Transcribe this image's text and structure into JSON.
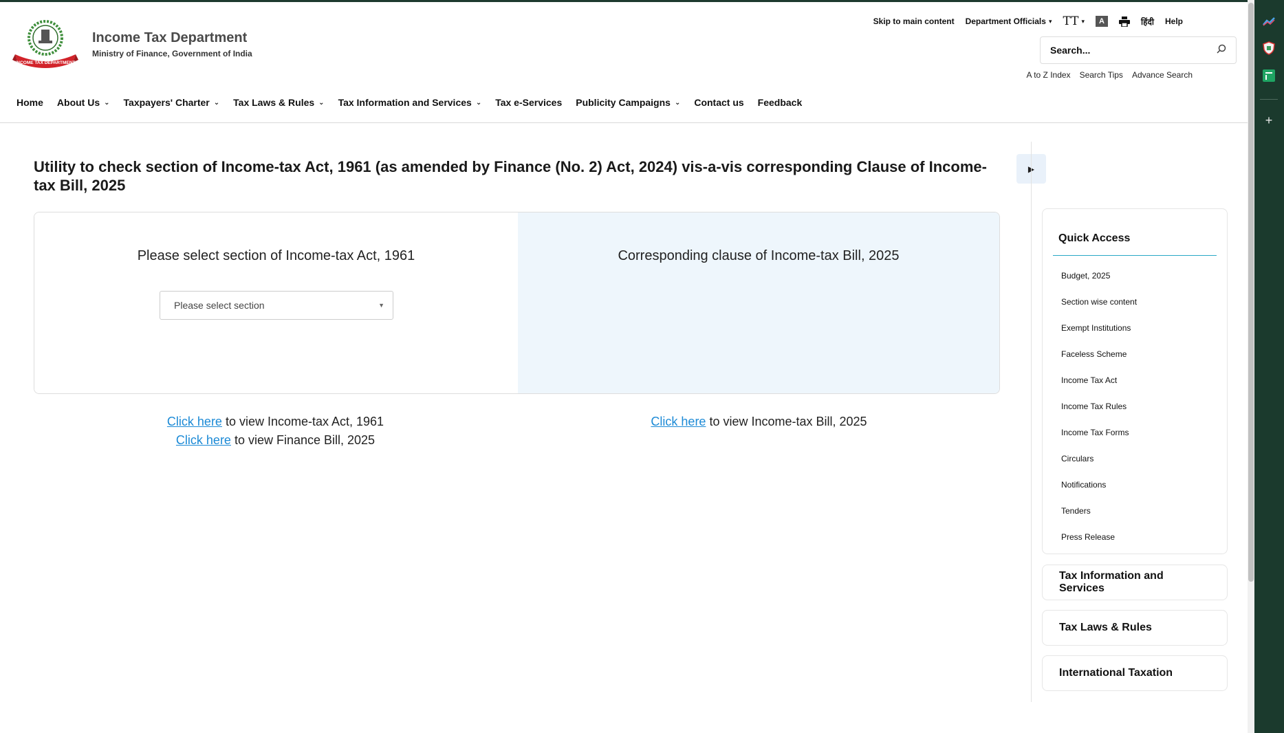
{
  "header": {
    "logo_ribbon": "INCOME TAX DEPARTMENT",
    "title": "Income Tax Department",
    "subtitle": "Ministry of Finance, Government of India"
  },
  "utility": {
    "skip": "Skip to main content",
    "officials": "Department Officials",
    "text_size": "TT",
    "contrast": "A",
    "hindi": "हिंदी",
    "help": "Help"
  },
  "search": {
    "placeholder": "Search...",
    "links": [
      "A to Z Index",
      "Search Tips",
      "Advance Search"
    ]
  },
  "nav": [
    {
      "label": "Home",
      "dropdown": false
    },
    {
      "label": "About Us",
      "dropdown": true
    },
    {
      "label": "Taxpayers' Charter",
      "dropdown": true
    },
    {
      "label": "Tax Laws & Rules",
      "dropdown": true
    },
    {
      "label": "Tax Information and Services",
      "dropdown": true
    },
    {
      "label": "Tax e-Services",
      "dropdown": false
    },
    {
      "label": "Publicity Campaigns",
      "dropdown": true
    },
    {
      "label": "Contact us",
      "dropdown": false
    },
    {
      "label": "Feedback",
      "dropdown": false
    }
  ],
  "main": {
    "title": "Utility to check section of Income-tax Act, 1961 (as amended by Finance (No. 2) Act, 2024) vis-a-vis corresponding Clause of Income-tax Bill, 2025",
    "left_heading": "Please select section of Income-tax Act, 1961",
    "select_placeholder": "Please select section",
    "right_heading": "Corresponding clause of Income-tax Bill, 2025",
    "link_text": "Click here",
    "left_link1_suffix": " to view Income-tax Act, 1961",
    "left_link2_suffix": " to view Finance Bill, 2025",
    "right_link_suffix": " to view Income-tax Bill, 2025"
  },
  "sidebar": {
    "quick_access_title": "Quick Access",
    "quick_access_items": [
      "Budget, 2025",
      "Section wise content",
      "Exempt Institutions",
      "Faceless Scheme",
      "Income Tax Act",
      "Income Tax Rules",
      "Income Tax Forms",
      "Circulars",
      "Notifications",
      "Tenders",
      "Press Release"
    ],
    "cards": [
      "Tax Information and Services",
      "Tax Laws & Rules",
      "International Taxation"
    ]
  },
  "colors": {
    "link": "#1c8ad6",
    "accent_line": "#28a8c6",
    "panel_right_bg": "#eef6fc",
    "browser_frame": "#1b3a2d"
  }
}
